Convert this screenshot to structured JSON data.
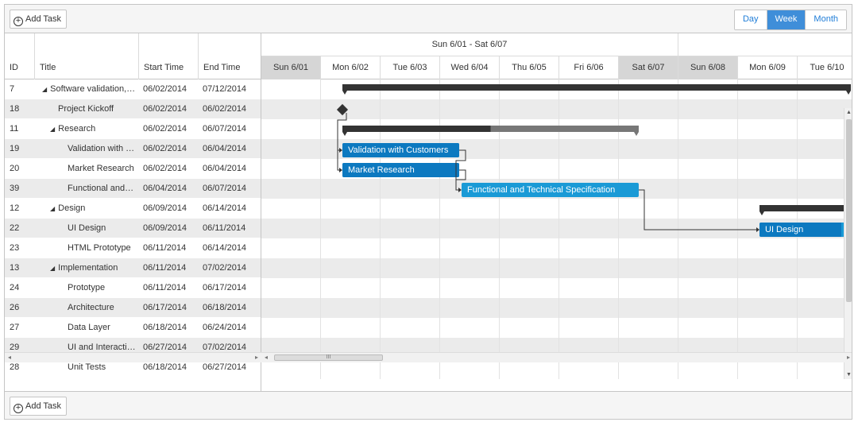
{
  "toolbar": {
    "add_task": "Add Task",
    "views": [
      "Day",
      "Week",
      "Month"
    ],
    "active_view": "Week"
  },
  "grid": {
    "columns": [
      "ID",
      "Title",
      "Start Time",
      "End Time"
    ],
    "rows": [
      {
        "id": "7",
        "title": "Software validation, research and implementation",
        "start": "06/02/2014",
        "end": "07/12/2014",
        "level": 0,
        "summary": true
      },
      {
        "id": "18",
        "title": "Project Kickoff",
        "start": "06/02/2014",
        "end": "06/02/2014",
        "level": 1,
        "summary": false
      },
      {
        "id": "11",
        "title": "Research",
        "start": "06/02/2014",
        "end": "06/07/2014",
        "level": 1,
        "summary": true
      },
      {
        "id": "19",
        "title": "Validation with Customers",
        "start": "06/02/2014",
        "end": "06/04/2014",
        "level": 2,
        "summary": false
      },
      {
        "id": "20",
        "title": "Market Research",
        "start": "06/02/2014",
        "end": "06/04/2014",
        "level": 2,
        "summary": false
      },
      {
        "id": "39",
        "title": "Functional and Technical Specification",
        "start": "06/04/2014",
        "end": "06/07/2014",
        "level": 2,
        "summary": false
      },
      {
        "id": "12",
        "title": "Design",
        "start": "06/09/2014",
        "end": "06/14/2014",
        "level": 1,
        "summary": true
      },
      {
        "id": "22",
        "title": "UI Design",
        "start": "06/09/2014",
        "end": "06/11/2014",
        "level": 2,
        "summary": false
      },
      {
        "id": "23",
        "title": "HTML Prototype",
        "start": "06/11/2014",
        "end": "06/14/2014",
        "level": 2,
        "summary": false
      },
      {
        "id": "13",
        "title": "Implementation",
        "start": "06/11/2014",
        "end": "07/02/2014",
        "level": 1,
        "summary": true
      },
      {
        "id": "24",
        "title": "Prototype",
        "start": "06/11/2014",
        "end": "06/17/2014",
        "level": 2,
        "summary": false
      },
      {
        "id": "26",
        "title": "Architecture",
        "start": "06/17/2014",
        "end": "06/18/2014",
        "level": 2,
        "summary": false
      },
      {
        "id": "27",
        "title": "Data Layer",
        "start": "06/18/2014",
        "end": "06/24/2014",
        "level": 2,
        "summary": false
      },
      {
        "id": "29",
        "title": "UI and Interaction",
        "start": "06/27/2014",
        "end": "07/02/2014",
        "level": 2,
        "summary": false
      },
      {
        "id": "28",
        "title": "Unit Tests",
        "start": "06/18/2014",
        "end": "06/27/2014",
        "level": 2,
        "summary": false
      }
    ]
  },
  "timeline": {
    "week_label": "Sun 6/01 - Sat 6/07",
    "days": [
      "Sun 6/01",
      "Mon 6/02",
      "Tue 6/03",
      "Wed 6/04",
      "Thu 6/05",
      "Fri 6/06",
      "Sat 6/07",
      "Sun 6/08",
      "Mon 6/09",
      "Tue 6/10"
    ],
    "task_labels": {
      "validation": "Validation with Customers",
      "market": "Market Research",
      "spec": "Functional and Technical Specification",
      "ui": "UI Design"
    }
  }
}
